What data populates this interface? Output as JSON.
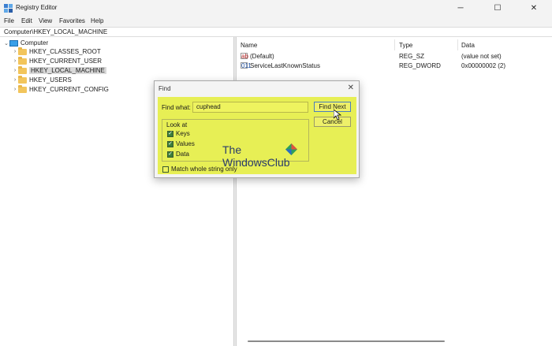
{
  "window": {
    "title": "Registry Editor",
    "controls": {
      "minimize": "─",
      "maximize": "☐",
      "close": "✕"
    }
  },
  "menu": [
    "File",
    "Edit",
    "View",
    "Favorites",
    "Help"
  ],
  "address": "Computer\\HKEY_LOCAL_MACHINE",
  "tree": {
    "root": "Computer",
    "root_chevron": "⌄",
    "child_chevron": "›",
    "items": [
      {
        "label": "HKEY_CLASSES_ROOT",
        "selected": false
      },
      {
        "label": "HKEY_CURRENT_USER",
        "selected": false
      },
      {
        "label": "HKEY_LOCAL_MACHINE",
        "selected": true
      },
      {
        "label": "HKEY_USERS",
        "selected": false
      },
      {
        "label": "HKEY_CURRENT_CONFIG",
        "selected": false
      }
    ]
  },
  "list": {
    "columns": {
      "name": "Name",
      "type": "Type",
      "data": "Data"
    },
    "rows": [
      {
        "icon": "string-value-icon",
        "icon_glyph": "ab",
        "name": "(Default)",
        "type": "REG_SZ",
        "data": "(value not set)"
      },
      {
        "icon": "binary-value-icon",
        "icon_glyph": "011",
        "name": "ServiceLastKnownStatus",
        "type": "REG_DWORD",
        "data": "0x00000002 (2)"
      }
    ]
  },
  "find_dialog": {
    "title": "Find",
    "close_glyph": "✕",
    "find_what_label": "Find what:",
    "find_what_value": "cuphead",
    "find_next_label": "Find Next",
    "cancel_label": "Cancel",
    "look_at_label": "Look at",
    "options": [
      {
        "label": "Keys",
        "checked": true
      },
      {
        "label": "Values",
        "checked": true
      },
      {
        "label": "Data",
        "checked": true
      }
    ],
    "match_whole_label": "Match whole string only",
    "match_whole_checked": false,
    "check_glyph": "✓"
  },
  "watermark": {
    "line1": "The",
    "line2": "WindowsClub"
  },
  "colors": {
    "highlight": "#e7ef55",
    "selection": "#d9d9d9",
    "folder": "#f2c55c",
    "accent": "#4a7dbd"
  }
}
